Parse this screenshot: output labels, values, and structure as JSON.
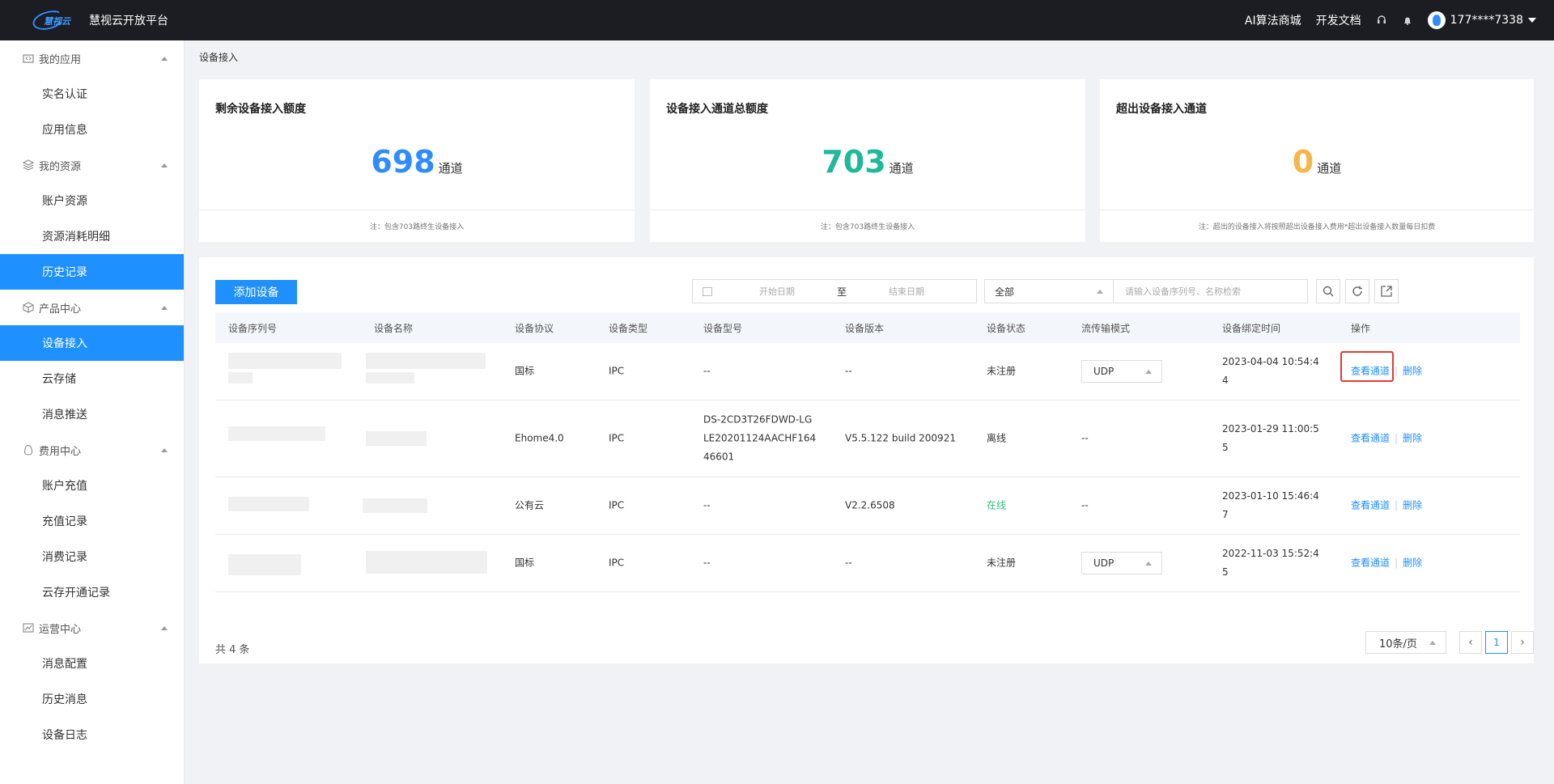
{
  "header": {
    "logo_text": "慧视云",
    "title": "慧视云开放平台",
    "links": [
      "AI算法商城",
      "开发文档"
    ],
    "user": "177****7338"
  },
  "sidebar": {
    "groups": [
      {
        "label": "我的应用",
        "icon": "app-icon",
        "items": [
          "实名认证",
          "应用信息"
        ]
      },
      {
        "label": "我的资源",
        "icon": "stack-icon",
        "items": [
          "账户资源",
          "资源消耗明细",
          "历史记录"
        ]
      },
      {
        "label": "产品中心",
        "icon": "cube-icon",
        "items": [
          "设备接入",
          "云存储",
          "消息推送"
        ]
      },
      {
        "label": "费用中心",
        "icon": "money-icon",
        "items": [
          "账户充值",
          "充值记录",
          "消费记录",
          "云存开通记录"
        ]
      },
      {
        "label": "运营中心",
        "icon": "chart-icon",
        "items": [
          "消息配置",
          "历史消息",
          "设备日志"
        ]
      }
    ],
    "active_items": [
      "历史记录",
      "设备接入"
    ]
  },
  "breadcrumb": "设备接入",
  "cards": [
    {
      "title": "剩余设备接入额度",
      "value": "698",
      "unit": "通道",
      "color": "#2f8cff",
      "note": "注：包含703路终生设备接入"
    },
    {
      "title": "设备接入通道总额度",
      "value": "703",
      "unit": "通道",
      "color": "#1fb89a",
      "note": "注：包含703路终生设备接入"
    },
    {
      "title": "超出设备接入通道",
      "value": "0",
      "unit": "通道",
      "color": "#f7b54a",
      "note": "注：超出的设备接入将按照超出设备接入费用*超出设备接入数量每日扣费"
    }
  ],
  "toolbar": {
    "add_label": "添加设备",
    "date_start_placeholder": "开始日期",
    "date_separator": "至",
    "date_end_placeholder": "结束日期",
    "filter_value": "全部",
    "search_placeholder": "请输入设备序列号、名称检索"
  },
  "table": {
    "headers": [
      "设备序列号",
      "设备名称",
      "设备协议",
      "设备类型",
      "设备型号",
      "设备版本",
      "设备状态",
      "流传输模式",
      "设备绑定时间",
      "操作"
    ],
    "rows": [
      {
        "protocol": "国标",
        "type": "IPC",
        "model": "--",
        "version": "--",
        "status": "未注册",
        "mode": "UDP",
        "bind_time": "2023-04-04 10:54:44"
      },
      {
        "protocol": "Ehome4.0",
        "type": "IPC",
        "model": "DS-2CD3T26FDWD-LGLE20201124AACHF16446601",
        "version": "V5.5.122 build 200921",
        "status": "离线",
        "mode": "--",
        "bind_time": "2023-01-29 11:00:55"
      },
      {
        "protocol": "公有云",
        "type": "IPC",
        "model": "--",
        "version": "V2.2.6508",
        "status": "在线",
        "mode": "--",
        "bind_time": "2023-01-10 15:46:47"
      },
      {
        "protocol": "国标",
        "type": "IPC",
        "model": "--",
        "version": "--",
        "status": "未注册",
        "mode": "UDP",
        "bind_time": "2022-11-03 15:52:45"
      }
    ],
    "action_view": "查看通道",
    "action_delete": "删除"
  },
  "footer": {
    "total": "共 4 条",
    "page_size": "10条/页",
    "current_page": "1"
  },
  "colors": {
    "accent": "#1e90ff",
    "online": "#2ec27e",
    "highlight": "#e53935"
  }
}
